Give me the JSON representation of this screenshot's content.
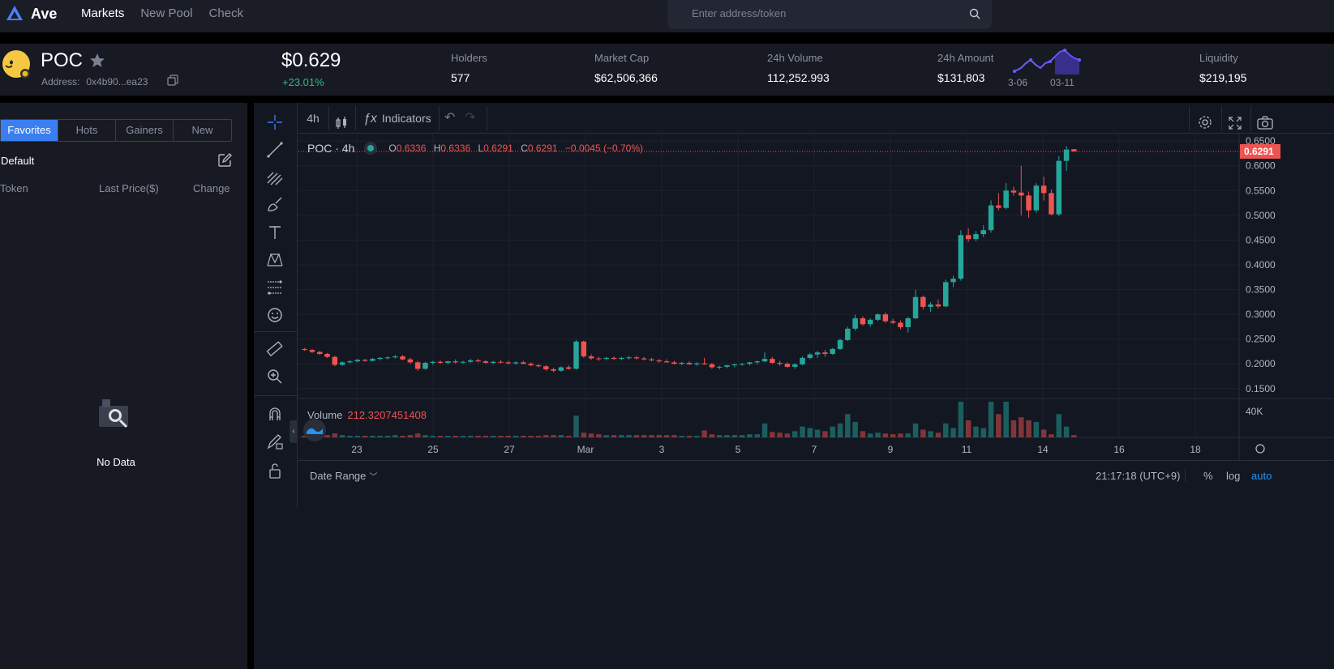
{
  "app": {
    "name": "Ave"
  },
  "nav": {
    "items": [
      "Markets",
      "New Pool",
      "Check"
    ]
  },
  "search": {
    "placeholder": "Enter address/token"
  },
  "token": {
    "symbol": "POC",
    "address_label": "Address:",
    "address": "0x4b90...ea23",
    "price": "$0.629",
    "change": "+23.01%"
  },
  "stats": [
    {
      "label": "Holders",
      "value": "577"
    },
    {
      "label": "Market Cap",
      "value": "$62,506,366"
    },
    {
      "label": "24h Volume",
      "value": "112,252.993"
    },
    {
      "label": "24h Amount",
      "value": "$131,803"
    },
    {
      "label": "Liquidity",
      "value": "$219,195"
    }
  ],
  "sparkline": {
    "dates": [
      "3-06",
      "03-11"
    ],
    "color": "#6a5cff"
  },
  "sidebar": {
    "tabs": [
      "Favorites",
      "Hots",
      "Gainers",
      "New"
    ],
    "active_tab": "Favorites",
    "group": "Default",
    "columns": [
      "Token",
      "Last Price($)",
      "Change"
    ],
    "empty": "No Data"
  },
  "chart": {
    "toolbar": {
      "interval": "4h",
      "indicators": "Indicators"
    },
    "legend": {
      "symbol": "POC · 4h",
      "o_label": "O",
      "o": "0.6336",
      "h_label": "H",
      "h": "0.6336",
      "l_label": "L",
      "l": "0.6291",
      "c_label": "C",
      "c": "0.6291",
      "delta": "−0.0045 (−0.70%)"
    },
    "volume_label": "Volume",
    "volume_value": "212.3207451408",
    "bottom": {
      "date_range": "Date Range",
      "time": "21:17:18 (UTC+9)",
      "pct": "%",
      "log": "log",
      "auto": "auto"
    },
    "colors": {
      "up": "#26a69a",
      "down": "#ef5350",
      "bg": "#131722",
      "grid": "#1e222d"
    }
  },
  "chart_data": {
    "type": "candlestick",
    "title": "",
    "y_axis": {
      "ticks": [
        "0.6500",
        "0.6000",
        "0.5500",
        "0.5000",
        "0.4500",
        "0.4000",
        "0.3500",
        "0.3000",
        "0.2500",
        "0.2000",
        "0.1500"
      ],
      "range": [
        0.13,
        0.665
      ],
      "last_price": "0.6291"
    },
    "volume_axis": {
      "ticks": [
        "40K"
      ]
    },
    "x_axis": {
      "ticks": [
        "23",
        "25",
        "27",
        "Mar",
        "3",
        "5",
        "7",
        "9",
        "11",
        "14",
        "16",
        "18"
      ]
    },
    "candles": [
      [
        0.23,
        0.232,
        0.226,
        0.228
      ],
      [
        0.228,
        0.23,
        0.222,
        0.224
      ],
      [
        0.224,
        0.226,
        0.218,
        0.22
      ],
      [
        0.22,
        0.222,
        0.212,
        0.214
      ],
      [
        0.214,
        0.216,
        0.195,
        0.198
      ],
      [
        0.198,
        0.205,
        0.196,
        0.203
      ],
      [
        0.203,
        0.208,
        0.201,
        0.205
      ],
      [
        0.205,
        0.21,
        0.203,
        0.208
      ],
      [
        0.208,
        0.21,
        0.204,
        0.206
      ],
      [
        0.206,
        0.212,
        0.205,
        0.21
      ],
      [
        0.21,
        0.214,
        0.207,
        0.212
      ],
      [
        0.212,
        0.215,
        0.209,
        0.213
      ],
      [
        0.213,
        0.218,
        0.211,
        0.215
      ],
      [
        0.215,
        0.218,
        0.207,
        0.209
      ],
      [
        0.209,
        0.212,
        0.2,
        0.203
      ],
      [
        0.203,
        0.206,
        0.186,
        0.19
      ],
      [
        0.19,
        0.204,
        0.188,
        0.202
      ],
      [
        0.202,
        0.206,
        0.198,
        0.204
      ],
      [
        0.204,
        0.207,
        0.2,
        0.202
      ],
      [
        0.202,
        0.206,
        0.199,
        0.205
      ],
      [
        0.205,
        0.209,
        0.201,
        0.203
      ],
      [
        0.203,
        0.206,
        0.2,
        0.204
      ],
      [
        0.204,
        0.21,
        0.202,
        0.207
      ],
      [
        0.207,
        0.21,
        0.203,
        0.205
      ],
      [
        0.205,
        0.208,
        0.2,
        0.202
      ],
      [
        0.202,
        0.206,
        0.199,
        0.204
      ],
      [
        0.204,
        0.208,
        0.201,
        0.203
      ],
      [
        0.203,
        0.206,
        0.199,
        0.201
      ],
      [
        0.201,
        0.205,
        0.198,
        0.203
      ],
      [
        0.203,
        0.206,
        0.199,
        0.2
      ],
      [
        0.2,
        0.203,
        0.195,
        0.197
      ],
      [
        0.197,
        0.2,
        0.193,
        0.195
      ],
      [
        0.195,
        0.197,
        0.186,
        0.189
      ],
      [
        0.189,
        0.192,
        0.183,
        0.186
      ],
      [
        0.186,
        0.195,
        0.184,
        0.193
      ],
      [
        0.193,
        0.197,
        0.188,
        0.19
      ],
      [
        0.19,
        0.248,
        0.188,
        0.245
      ],
      [
        0.245,
        0.247,
        0.212,
        0.215
      ],
      [
        0.215,
        0.219,
        0.208,
        0.211
      ],
      [
        0.211,
        0.214,
        0.206,
        0.21
      ],
      [
        0.21,
        0.214,
        0.207,
        0.212
      ],
      [
        0.212,
        0.215,
        0.208,
        0.21
      ],
      [
        0.21,
        0.214,
        0.207,
        0.212
      ],
      [
        0.212,
        0.216,
        0.209,
        0.213
      ],
      [
        0.213,
        0.216,
        0.209,
        0.211
      ],
      [
        0.211,
        0.214,
        0.207,
        0.209
      ],
      [
        0.209,
        0.212,
        0.205,
        0.207
      ],
      [
        0.207,
        0.21,
        0.202,
        0.205
      ],
      [
        0.205,
        0.209,
        0.202,
        0.203
      ],
      [
        0.203,
        0.206,
        0.199,
        0.2
      ],
      [
        0.2,
        0.204,
        0.197,
        0.202
      ],
      [
        0.202,
        0.205,
        0.198,
        0.199
      ],
      [
        0.199,
        0.203,
        0.196,
        0.201
      ],
      [
        0.201,
        0.212,
        0.198,
        0.199
      ],
      [
        0.199,
        0.202,
        0.19,
        0.193
      ],
      [
        0.193,
        0.196,
        0.189,
        0.194
      ],
      [
        0.194,
        0.198,
        0.191,
        0.197
      ],
      [
        0.197,
        0.2,
        0.193,
        0.199
      ],
      [
        0.199,
        0.202,
        0.196,
        0.2
      ],
      [
        0.2,
        0.204,
        0.197,
        0.203
      ],
      [
        0.203,
        0.207,
        0.199,
        0.205
      ],
      [
        0.205,
        0.223,
        0.203,
        0.21
      ],
      [
        0.21,
        0.214,
        0.2,
        0.202
      ],
      [
        0.202,
        0.206,
        0.196,
        0.2
      ],
      [
        0.2,
        0.203,
        0.192,
        0.194
      ],
      [
        0.194,
        0.201,
        0.19,
        0.199
      ],
      [
        0.199,
        0.215,
        0.197,
        0.212
      ],
      [
        0.212,
        0.222,
        0.209,
        0.219
      ],
      [
        0.219,
        0.226,
        0.212,
        0.223
      ],
      [
        0.223,
        0.228,
        0.214,
        0.22
      ],
      [
        0.22,
        0.232,
        0.218,
        0.23
      ],
      [
        0.23,
        0.251,
        0.228,
        0.248
      ],
      [
        0.248,
        0.275,
        0.246,
        0.271
      ],
      [
        0.271,
        0.299,
        0.267,
        0.292
      ],
      [
        0.292,
        0.296,
        0.277,
        0.28
      ],
      [
        0.28,
        0.292,
        0.275,
        0.289
      ],
      [
        0.289,
        0.302,
        0.286,
        0.3
      ],
      [
        0.3,
        0.304,
        0.283,
        0.286
      ],
      [
        0.286,
        0.291,
        0.28,
        0.283
      ],
      [
        0.283,
        0.288,
        0.27,
        0.274
      ],
      [
        0.274,
        0.295,
        0.263,
        0.292
      ],
      [
        0.292,
        0.35,
        0.29,
        0.335
      ],
      [
        0.335,
        0.338,
        0.31,
        0.315
      ],
      [
        0.315,
        0.325,
        0.305,
        0.32
      ],
      [
        0.32,
        0.33,
        0.312,
        0.316
      ],
      [
        0.316,
        0.37,
        0.314,
        0.365
      ],
      [
        0.365,
        0.378,
        0.355,
        0.372
      ],
      [
        0.372,
        0.47,
        0.368,
        0.46
      ],
      [
        0.46,
        0.474,
        0.446,
        0.452
      ],
      [
        0.452,
        0.468,
        0.448,
        0.462
      ],
      [
        0.462,
        0.48,
        0.456,
        0.47
      ],
      [
        0.47,
        0.53,
        0.465,
        0.52
      ],
      [
        0.52,
        0.545,
        0.51,
        0.515
      ],
      [
        0.515,
        0.565,
        0.512,
        0.55
      ],
      [
        0.55,
        0.558,
        0.54,
        0.546
      ],
      [
        0.546,
        0.6,
        0.5,
        0.54
      ],
      [
        0.54,
        0.548,
        0.495,
        0.51
      ],
      [
        0.51,
        0.565,
        0.505,
        0.56
      ],
      [
        0.56,
        0.578,
        0.53,
        0.545
      ],
      [
        0.545,
        0.552,
        0.5,
        0.502
      ],
      [
        0.502,
        0.62,
        0.498,
        0.61
      ],
      [
        0.61,
        0.64,
        0.59,
        0.633
      ],
      [
        0.6336,
        0.6336,
        0.6291,
        0.6291
      ]
    ],
    "volumes": [
      2,
      2,
      2,
      3,
      5,
      3,
      2,
      2,
      2,
      2,
      2,
      2,
      3,
      2,
      3,
      5,
      3,
      2,
      2,
      2,
      2,
      2,
      2,
      2,
      2,
      2,
      2,
      2,
      2,
      2,
      2,
      2,
      3,
      3,
      3,
      2,
      28,
      6,
      5,
      4,
      3,
      3,
      3,
      3,
      3,
      3,
      3,
      3,
      3,
      3,
      2,
      2,
      2,
      9,
      4,
      3,
      3,
      3,
      3,
      4,
      4,
      18,
      7,
      6,
      5,
      8,
      14,
      12,
      10,
      8,
      14,
      18,
      30,
      20,
      8,
      5,
      6,
      5,
      4,
      5,
      5,
      18,
      10,
      8,
      6,
      18,
      12,
      46,
      22,
      14,
      12,
      46,
      30,
      46,
      22,
      26,
      22,
      20,
      10,
      4,
      30,
      14,
      3
    ]
  }
}
